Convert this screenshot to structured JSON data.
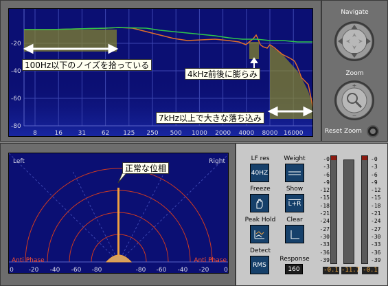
{
  "spectrum": {
    "y_ticks": [
      "-20",
      "-40",
      "-60",
      "-80"
    ],
    "x_ticks": [
      "8",
      "16",
      "31",
      "62",
      "125",
      "250",
      "500",
      "1000",
      "2000",
      "4000",
      "8000",
      "16000"
    ],
    "annotations": {
      "noise": "100Hz以下のノイズを拾っている",
      "bump": "4kHz前後に膨らみ",
      "drop": "7kHz以上で大きな落ち込み"
    }
  },
  "navigation": {
    "navigate_label": "Navigate",
    "zoom_label": "Zoom",
    "reset_zoom_label": "Reset Zoom"
  },
  "phase": {
    "left_label": "Left",
    "right_label": "Right",
    "anti_phase_left": "Anti Phase",
    "anti_phase_right": "Anti Phase",
    "callout": "正常な位相",
    "x_ticks": [
      "0",
      "-20",
      "-40",
      "-60",
      "-80",
      "-80",
      "-60",
      "-40",
      "-20",
      "0"
    ]
  },
  "controls": {
    "lf_res": {
      "label": "LF res",
      "value": "40HZ"
    },
    "weight": {
      "label": "Weight"
    },
    "freeze": {
      "label": "Freeze"
    },
    "show": {
      "label": "Show",
      "value": "L+R"
    },
    "peak_hold": {
      "label": "Peak Hold"
    },
    "clear": {
      "label": "Clear"
    },
    "detect": {
      "label": "Detect",
      "value": "RMS"
    },
    "response": {
      "label": "Response",
      "value": "160"
    }
  },
  "meters": {
    "scale": [
      "-0",
      "-3",
      "-6",
      "-9",
      "-12",
      "-15",
      "-18",
      "-21",
      "-24",
      "-27",
      "-30",
      "-33",
      "-36",
      "-39"
    ],
    "readouts": [
      "-0.1",
      "-11.7",
      "-0.1"
    ]
  }
}
